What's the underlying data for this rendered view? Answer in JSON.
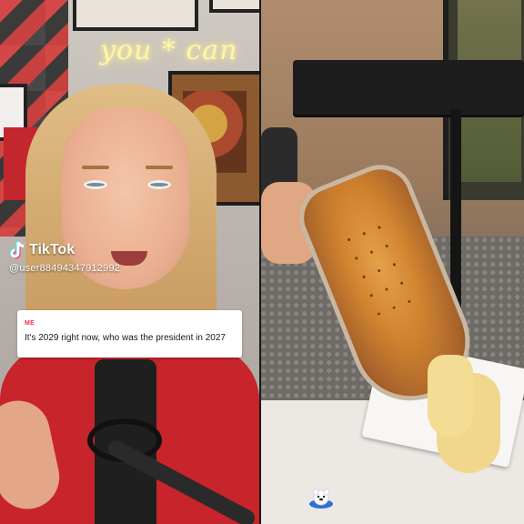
{
  "left_video": {
    "neon_sign": "you * can",
    "watermark": {
      "brand": "TikTok",
      "username": "@user88494347912992"
    },
    "comment": {
      "label": "ME",
      "text": "It's 2029 right now, who was the president in 2027"
    }
  },
  "right_video": {
    "sticker": "polar-bear-sticker"
  },
  "colors": {
    "tiktok_accent": "#fe2c55",
    "shirt_red": "#c7242c",
    "cheese_gold": "#d1842f"
  }
}
